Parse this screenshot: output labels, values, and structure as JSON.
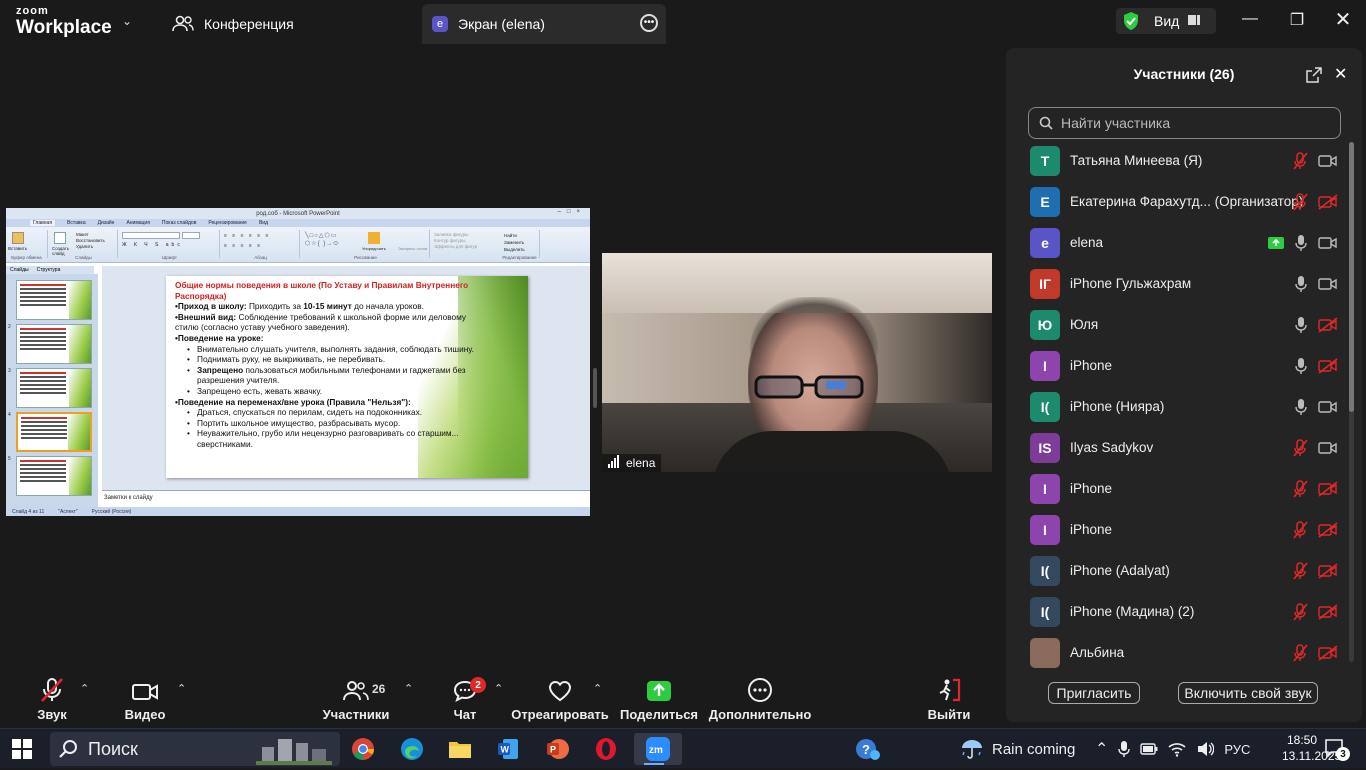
{
  "app": {
    "logo_top": "zoom",
    "logo_bottom": "Workplace"
  },
  "tabs": [
    {
      "label": "Конференция"
    },
    {
      "label": "Экран (elena)",
      "badge": "e"
    }
  ],
  "view_button": {
    "label": "Вид"
  },
  "powerpoint": {
    "window_title": "род.соб - Microsoft PowerPoint",
    "ribbon_tabs": [
      "Главная",
      "Вставка",
      "Дизайн",
      "Анимация",
      "Показ слайдов",
      "Рецензирование",
      "Вид"
    ],
    "ribbon_groups": [
      "Буфер обмена",
      "Слайды",
      "Шрифт",
      "Абзац",
      "Рисование",
      "Редактирование"
    ],
    "ribbon_buttons": {
      "paste": "Вставить",
      "new_slide": "Создать слайд",
      "layout": "Макет",
      "reset": "Восстановить",
      "delete": "Удалить",
      "arrange": "Упорядочить",
      "quick_styles": "Экспресс-стили",
      "fill": "Заливка фигуры",
      "outline": "Контур фигуры",
      "effects": "Эффекты для фигур",
      "find": "Найти",
      "replace": "Заменить",
      "select": "Выделить"
    },
    "left_tabs": [
      "Слайды",
      "Структура"
    ],
    "thumb_numbers": [
      "2",
      "3",
      "4",
      "5"
    ],
    "slide": {
      "title": "Общие нормы поведения в школе (По Уставу и Правилам Внутреннего Распорядка)",
      "lines": [
        {
          "bold": "•Приход в школу:",
          "text": " Приходить за ",
          "bold2": "10-15 минут",
          "text2": " до начала уроков."
        },
        {
          "bold": "•Внешний вид:",
          "text": " Соблюдение требований к школьной форме или деловому стилю (согласно уставу учебного заведения)."
        },
        {
          "bold": "•Поведение на уроке:",
          "text": ""
        }
      ],
      "lesson_items": [
        {
          "text": "Внимательно слушать учителя, выполнять задания, соблюдать тишину."
        },
        {
          "text": "Поднимать руку, не выкрикивать, не перебивать."
        },
        {
          "bold": "Запрещено",
          "text": " пользоваться мобильными телефонами и гаджетами без разрешения учителя."
        },
        {
          "text": "Запрещено есть, жевать жвачку."
        }
      ],
      "break_heading": "•Поведение на переменах/вне урока (Правила \"Нельзя\"):",
      "break_items": [
        "Драться, спускаться по перилам, сидеть на подоконниках.",
        "Портить школьное имущество, разбрасывать мусор.",
        "Неуважительно, грубо или нецензурно разговаривать со старшим... сверстниками."
      ]
    },
    "notes_placeholder": "Заметки к слайду",
    "status": [
      "Слайд 4 из 11",
      "\"Аспект\"",
      "Русский (Россия)"
    ]
  },
  "video": {
    "name": "elena"
  },
  "participants_panel": {
    "title": "Участники (26)",
    "search_placeholder": "Найти участника",
    "participants": [
      {
        "initial": "Т",
        "name": "Татьяна Минеева (Я)",
        "color": "#1d8a6e",
        "mic": "muted",
        "cam": "on"
      },
      {
        "initial": "Е",
        "name": "Екатерина Фарахутд... (Организатор)",
        "color": "#1f6fb0",
        "mic": "muted",
        "cam": "off"
      },
      {
        "initial": "e",
        "name": "elena",
        "color": "#5a55c7",
        "mic": "on",
        "cam": "on",
        "sharing": true
      },
      {
        "initial": "IГ",
        "name": "iPhone Гульжахрам",
        "color": "#c0392b",
        "mic": "on",
        "cam": "on"
      },
      {
        "initial": "Ю",
        "name": "Юля",
        "color": "#1d8a6e",
        "mic": "on",
        "cam": "off"
      },
      {
        "initial": "I",
        "name": "iPhone",
        "color": "#8e44ad",
        "mic": "on",
        "cam": "off"
      },
      {
        "initial": "I(",
        "name": "iPhone (Нияра)",
        "color": "#1d8a6e",
        "mic": "on",
        "cam": "on"
      },
      {
        "initial": "IS",
        "name": "Ilyas Sadykov",
        "color": "#7d3c98",
        "mic": "muted",
        "cam": "on"
      },
      {
        "initial": "I",
        "name": "iPhone",
        "color": "#8e44ad",
        "mic": "muted",
        "cam": "off"
      },
      {
        "initial": "I",
        "name": "iPhone",
        "color": "#8e44ad",
        "mic": "muted",
        "cam": "off"
      },
      {
        "initial": "I(",
        "name": "iPhone (Adalyat)",
        "color": "#34495e",
        "mic": "muted",
        "cam": "off"
      },
      {
        "initial": "I(",
        "name": "iPhone (Мадина) (2)",
        "color": "#34495e",
        "mic": "muted",
        "cam": "off"
      },
      {
        "initial": "",
        "name": "Альбина",
        "color": "#8a6a5a",
        "mic": "muted",
        "cam": "off"
      }
    ],
    "invite_label": "Пригласить",
    "unmute_label": "Включить свой звук"
  },
  "toolbar": {
    "audio": "Звук",
    "video": "Видео",
    "participants": "Участники",
    "participants_count": "26",
    "chat": "Чат",
    "chat_badge": "2",
    "react": "Отреагировать",
    "share": "Поделиться",
    "more": "Дополнительно",
    "leave": "Выйти"
  },
  "taskbar": {
    "search": "Поиск",
    "weather": "Rain coming",
    "lang": "РУС",
    "time": "18:50",
    "date": "13.11.2025",
    "notifications": "3"
  },
  "colors": {
    "accent_green": "#2ecc40",
    "danger": "#e02828",
    "panel_bg": "#242424",
    "zoom_blue": "#2d8cff"
  }
}
